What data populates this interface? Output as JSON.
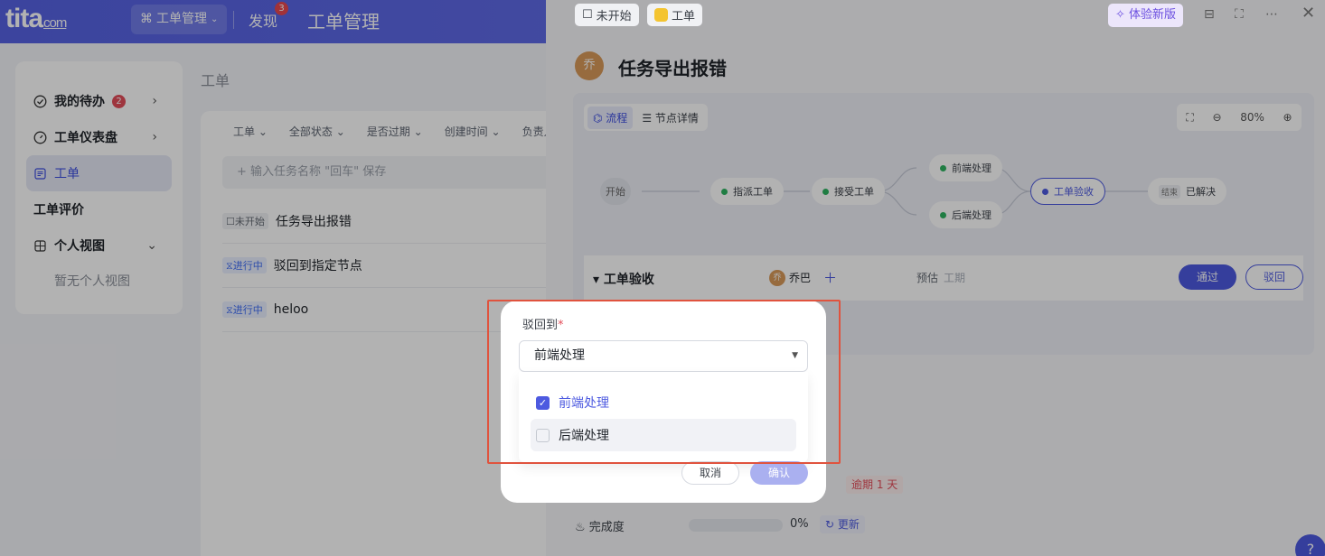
{
  "topbar": {
    "logo_main": "tita",
    "logo_sub": "com",
    "app_switch_label": "工单管理",
    "discover_label": "发现",
    "discover_badge": "3",
    "page_heading": "工单管理"
  },
  "sidebar": {
    "items": [
      {
        "label": "我的待办",
        "badge": "2"
      },
      {
        "label": "工单仪表盘"
      },
      {
        "label": "工单"
      },
      {
        "label": "工单评价"
      },
      {
        "label": "个人视图"
      }
    ],
    "empty_text": "暂无个人视图"
  },
  "main": {
    "title": "工单",
    "filters": [
      "工单",
      "全部状态",
      "是否过期",
      "创建时间",
      "负责人"
    ],
    "new_task_placeholder": "+ 输入任务名称 \"回车\" 保存",
    "tasks": [
      {
        "status": "未开始",
        "name": "任务导出报错"
      },
      {
        "status": "进行中",
        "name": "驳回到指定节点"
      },
      {
        "status": "进行中",
        "name": "heloo"
      }
    ]
  },
  "drawer": {
    "status_chip": "未开始",
    "type_chip": "工单",
    "try_new": "体验新版",
    "avatar_text": "乔",
    "title": "任务导出报错",
    "tabs": [
      "流程",
      "节点详情"
    ],
    "zoom": "80%",
    "flow_nodes": {
      "start": "开始",
      "assign": "指派工单",
      "accept": "接受工单",
      "frontend": "前端处理",
      "backend": "后端处理",
      "review": "工单验收",
      "end_tag": "结束",
      "resolved": "已解决"
    },
    "accept_section": {
      "title": "工单验收",
      "owner_avatar": "乔",
      "owner": "乔巴",
      "estimate_label": "预估",
      "estimate_value": "工期",
      "pass_label": "通过",
      "reject_label": "驳回"
    },
    "overdue": "逾期 1 天",
    "progress_label": "完成度",
    "progress_fraction": 0,
    "progress_value": "0%",
    "update_label": "更新",
    "help": "?"
  },
  "modal": {
    "label": "驳回到",
    "required_mark": "*",
    "selected": "前端处理",
    "options": [
      {
        "label": "前端处理",
        "checked": true
      },
      {
        "label": "后端处理",
        "checked": false
      }
    ],
    "cancel_label": "取消",
    "confirm_label": "确认"
  },
  "colors": {
    "brand": "#5662e3",
    "accent": "#4d5ae0",
    "danger": "#e34d59",
    "highlight": "#e0533e"
  }
}
